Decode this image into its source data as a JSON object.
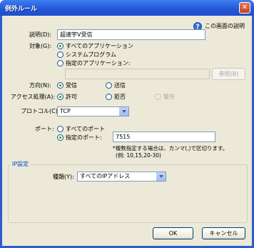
{
  "window": {
    "title": "例外ルール"
  },
  "help": {
    "label": "この画面の説明"
  },
  "description": {
    "label": "説明(D):",
    "value": "超速宇V受信"
  },
  "target": {
    "label": "対象(G):",
    "options": [
      "すべてのアプリケーション",
      "システムプログラム",
      "指定のアプリケーション:"
    ],
    "selected": 0,
    "app_path": "",
    "browse_label": "参照(B)"
  },
  "direction": {
    "label": "方向(N):",
    "options": [
      "受信",
      "送信"
    ],
    "selected": 0
  },
  "action": {
    "label": "アクセス処理(A):",
    "options": [
      "許可",
      "拒否",
      "警告"
    ],
    "selected": 0
  },
  "protocol": {
    "label": "プロトコル(C):",
    "value": "TCP"
  },
  "port": {
    "label": "ポート:",
    "options": [
      "すべてのポート",
      "指定のポート:"
    ],
    "selected": 1,
    "value": "7515",
    "hint_line1": "*複数指定する場合は、カンマ(,)で区切ります。",
    "hint_line2": "(例: 10,15,20-30)"
  },
  "ip": {
    "group_title": "IP設定",
    "type_label": "種類(Y):",
    "type_value": "すべてのIPアドレス"
  },
  "buttons": {
    "ok": "OK",
    "cancel": "キャンセル"
  },
  "colors": {
    "titlebar": "#2456d8",
    "dialog_bg": "#ece9d8",
    "group_title": "#0046d5",
    "radio_dot": "#21a121"
  }
}
